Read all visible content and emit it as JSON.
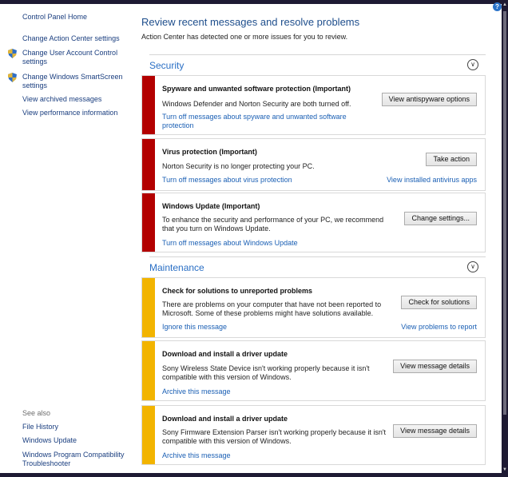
{
  "help_glyph": "?",
  "sidebar": {
    "home": "Control Panel Home",
    "links": [
      {
        "label": "Change Action Center settings",
        "shield": false
      },
      {
        "label": "Change User Account Control settings",
        "shield": true
      },
      {
        "label": "Change Windows SmartScreen settings",
        "shield": true
      },
      {
        "label": "View archived messages",
        "shield": false
      },
      {
        "label": "View performance information",
        "shield": false
      }
    ],
    "see_also": "See also",
    "see_also_links": [
      "File History",
      "Windows Update",
      "Windows Program Compatibility Troubleshooter"
    ]
  },
  "main": {
    "title": "Review recent messages and resolve problems",
    "subtitle": "Action Center has detected one or more issues for you to review.",
    "security": {
      "label": "Security",
      "cards": [
        {
          "title": "Spyware and unwanted software protection  (Important)",
          "desc": "Windows Defender and Norton Security are both turned off.",
          "link": "Turn off messages about spyware and unwanted software protection",
          "button": "View antispyware options",
          "right_link": ""
        },
        {
          "title": "Virus protection  (Important)",
          "desc": "Norton Security is no longer protecting your PC.",
          "link": "Turn off messages about virus protection",
          "button": "Take action",
          "right_link": "View installed antivirus apps"
        },
        {
          "title": "Windows Update  (Important)",
          "desc": "To enhance the security and performance of your PC, we recommend that you turn on Windows Update.",
          "link": "Turn off messages about Windows Update",
          "button": "Change settings...",
          "right_link": ""
        }
      ]
    },
    "maintenance": {
      "label": "Maintenance",
      "cards": [
        {
          "title": "Check for solutions to unreported problems",
          "desc": "There are problems on your computer that have not been reported to Microsoft. Some of these problems might have solutions available.",
          "link": "Ignore this message",
          "button": "Check for solutions",
          "right_link": "View problems to report"
        },
        {
          "title": "Download and install a driver update",
          "desc": "Sony Wireless State Device isn't working properly because it isn't compatible with this version of Windows.",
          "link": "Archive this message",
          "button": "View message details",
          "right_link": ""
        },
        {
          "title": "Download and install a driver update",
          "desc": "Sony Firmware Extension Parser isn't working properly because it isn't compatible with this version of Windows.",
          "link": "Archive this message",
          "button": "View message details",
          "right_link": ""
        }
      ]
    }
  },
  "colors": {
    "important": "#b30000",
    "warning": "#f2b400",
    "link": "#1a5fb4",
    "heading": "#2a6fc5"
  }
}
